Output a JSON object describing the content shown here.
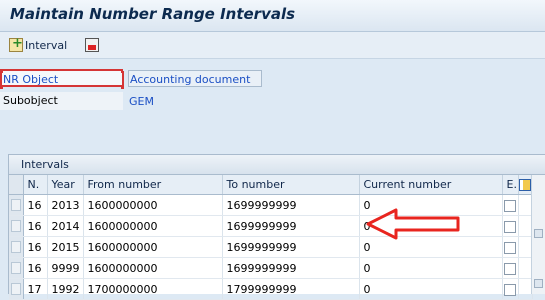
{
  "header": {
    "title": "Maintain Number Range Intervals"
  },
  "toolbar": {
    "interval_label": "Interval"
  },
  "form": {
    "nr_object_label": "NR Object",
    "nr_object_value": "Accounting document",
    "subobject_label": "Subobject",
    "subobject_value": "GEM"
  },
  "grid": {
    "title": "Intervals",
    "columns": {
      "n": "N.",
      "year": "Year",
      "from": "From number",
      "to": "To number",
      "current": "Current number",
      "ext": "E."
    },
    "rows": [
      {
        "n": "16",
        "year": "2013",
        "from": "1600000000",
        "to": "1699999999",
        "current": "0"
      },
      {
        "n": "16",
        "year": "2014",
        "from": "1600000000",
        "to": "1699999999",
        "current": "0"
      },
      {
        "n": "16",
        "year": "2015",
        "from": "1600000000",
        "to": "1699999999",
        "current": "0"
      },
      {
        "n": "16",
        "year": "9999",
        "from": "1600000000",
        "to": "1699999999",
        "current": "0"
      },
      {
        "n": "17",
        "year": "1992",
        "from": "1700000000",
        "to": "1799999999",
        "current": "0"
      }
    ]
  },
  "annotation": {
    "color": "#e8251f"
  }
}
